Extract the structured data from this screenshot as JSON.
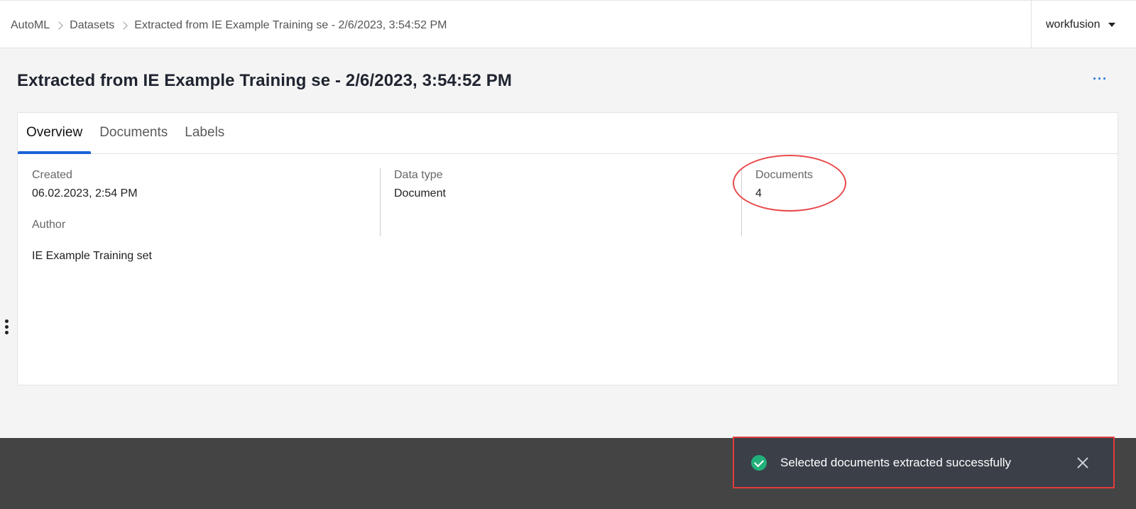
{
  "breadcrumb": {
    "items": [
      "AutoML",
      "Datasets"
    ],
    "current": "Extracted from IE Example Training se - 2/6/2023, 3:54:52 PM"
  },
  "user": {
    "name": "workfusion"
  },
  "page": {
    "title": "Extracted from IE Example Training se - 2/6/2023, 3:54:52 PM",
    "more_label": "···"
  },
  "tabs": [
    "Overview",
    "Documents",
    "Labels"
  ],
  "overview": {
    "created_label": "Created",
    "created_value": "06.02.2023, 2:54 PM",
    "author_label": "Author",
    "author_value": "IE Example Training set",
    "datatype_label": "Data type",
    "datatype_value": "Document",
    "documents_label": "Documents",
    "documents_value": "4"
  },
  "toast": {
    "message": "Selected documents extracted successfully"
  },
  "colors": {
    "accent": "#1a63d8",
    "success": "#22b07a",
    "annotation": "#e8484a",
    "footer_bg": "#444444"
  }
}
